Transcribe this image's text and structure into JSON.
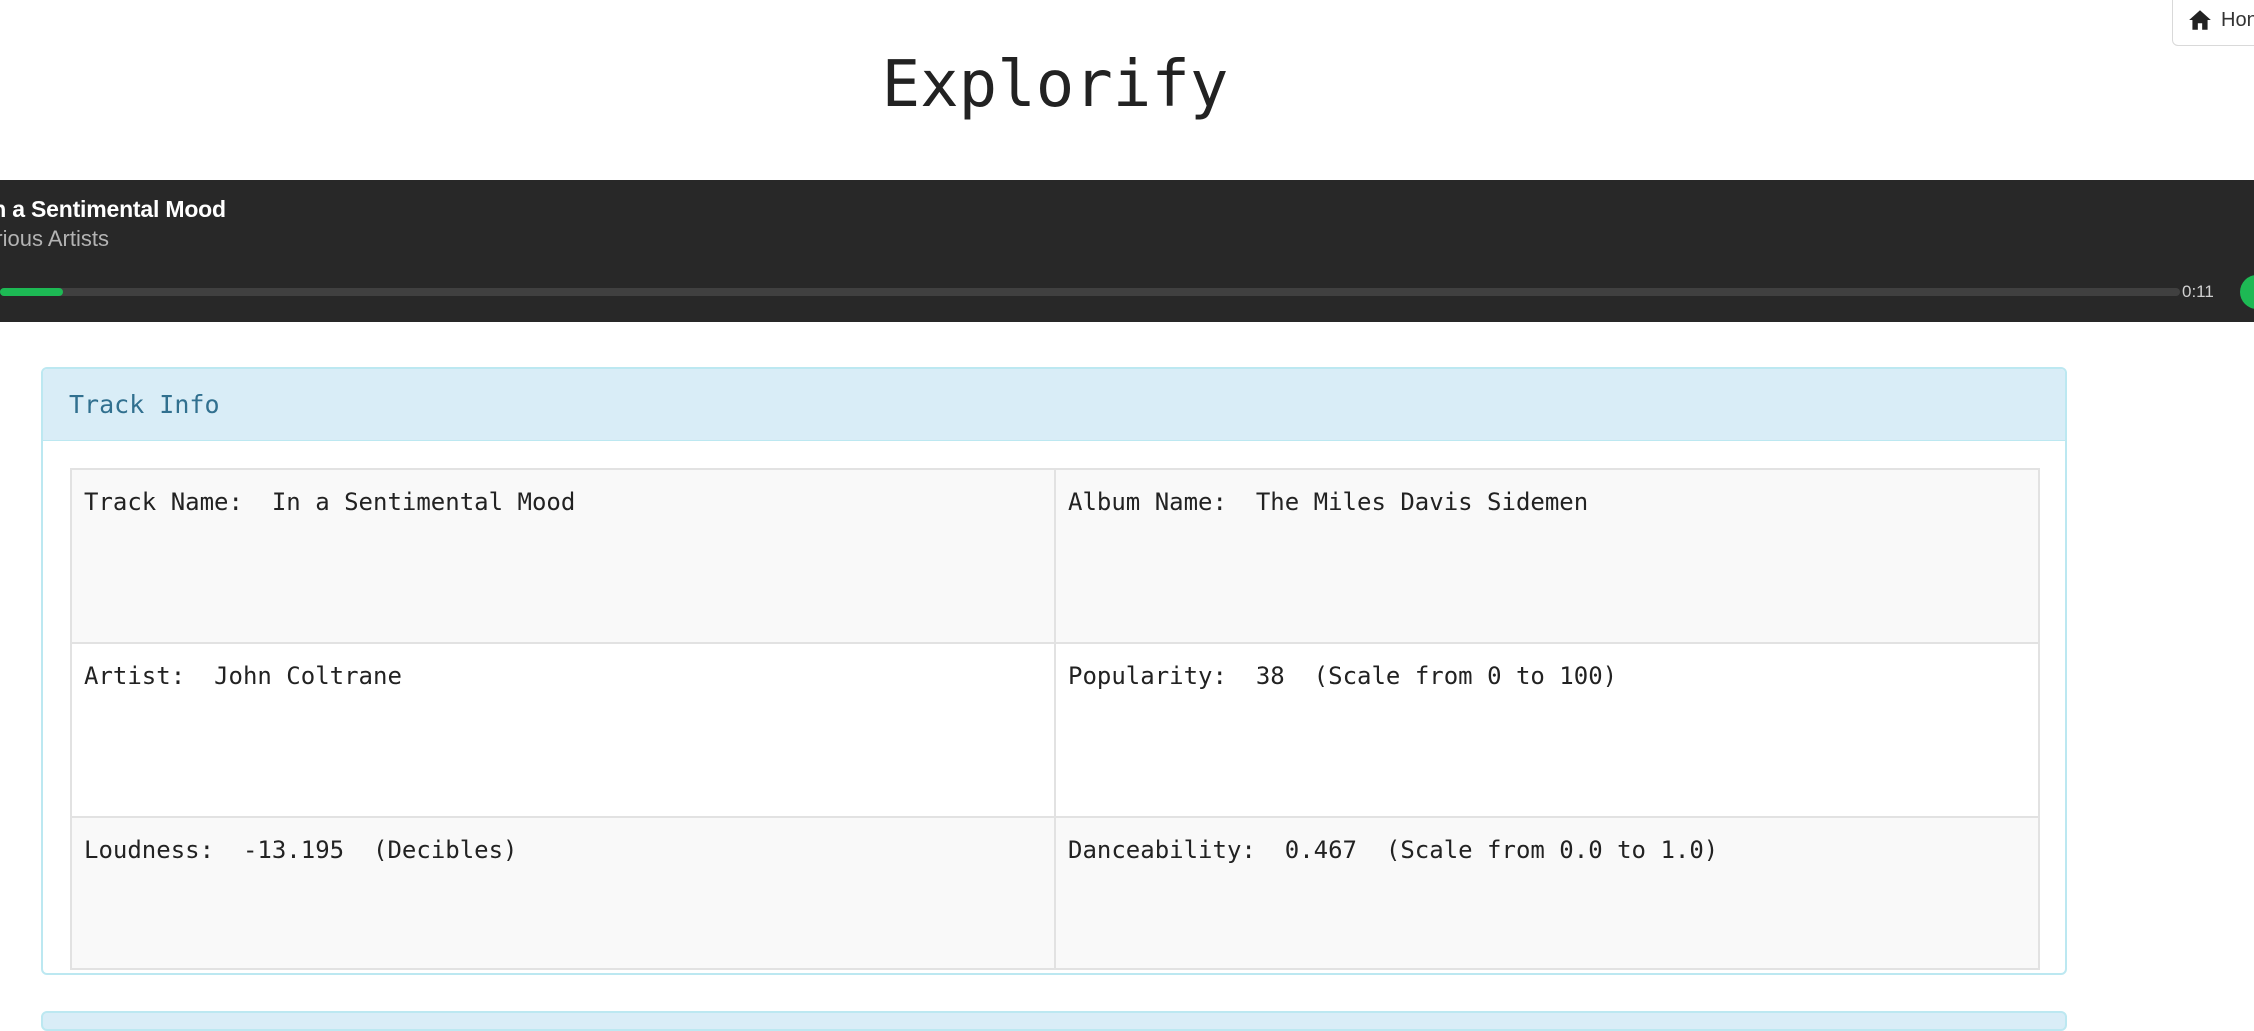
{
  "header": {
    "title": "Explorify",
    "home_label": "Hon"
  },
  "player": {
    "track_title": "In a Sentimental Mood",
    "artist": "Various Artists",
    "elapsed": "0:11",
    "progress_fraction": 0.029,
    "accent_color": "#1db954"
  },
  "track_info": {
    "heading": "Track Info",
    "rows": [
      [
        {
          "label": "Track Name:",
          "value": "In a Sentimental Mood",
          "note": ""
        },
        {
          "label": "Album Name:",
          "value": "The Miles Davis Sidemen",
          "note": ""
        }
      ],
      [
        {
          "label": "Artist:",
          "value": "John Coltrane",
          "note": ""
        },
        {
          "label": "Popularity:",
          "value": "38",
          "note": "(Scale from 0 to 100)"
        }
      ],
      [
        {
          "label": "Loudness:",
          "value": "-13.195",
          "note": "(Decibles)"
        },
        {
          "label": "Danceability:",
          "value": "0.467",
          "note": "(Scale from 0.0 to 1.0)"
        }
      ]
    ]
  }
}
